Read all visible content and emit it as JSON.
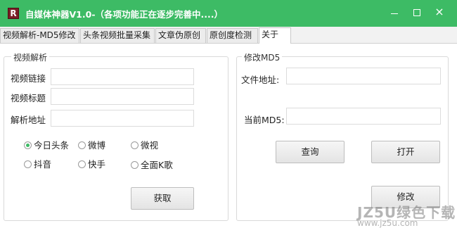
{
  "window": {
    "title": "自媒体神器V1.0-（各项功能正在逐步完善中....）",
    "app_icon_letter": "R",
    "close_glyph": "×"
  },
  "tabs": [
    {
      "label": "视频解析-MD5修改",
      "active": false
    },
    {
      "label": "头条视频批量采集",
      "active": false
    },
    {
      "label": "文章伪原创",
      "active": false
    },
    {
      "label": "原创度检测",
      "active": false
    },
    {
      "label": "关于",
      "active": true
    }
  ],
  "video_parse": {
    "group_title": "视频解析",
    "link_label": "视频链接",
    "link_value": "",
    "title_label": "视频标题",
    "title_value": "",
    "address_label": "解析地址",
    "address_value": "",
    "sources": [
      {
        "label": "今日头条",
        "checked": true
      },
      {
        "label": "微博",
        "checked": false
      },
      {
        "label": "微视",
        "checked": false
      },
      {
        "label": "抖音",
        "checked": false
      },
      {
        "label": "快手",
        "checked": false
      },
      {
        "label": "全面K歌",
        "checked": false
      }
    ],
    "fetch_button": "获取"
  },
  "md5": {
    "group_title": "修改MD5",
    "file_label": "文件地址:",
    "file_value": "",
    "current_label": "当前MD5:",
    "current_value": "",
    "query_button": "查询",
    "open_button": "打开",
    "modify_button": "修改"
  },
  "watermark": {
    "text": "JZ5U绿色下载",
    "url": "www.jz5u.com"
  },
  "colors": {
    "accent": "#3dbb65",
    "icon_bg": "#7a1e26"
  }
}
